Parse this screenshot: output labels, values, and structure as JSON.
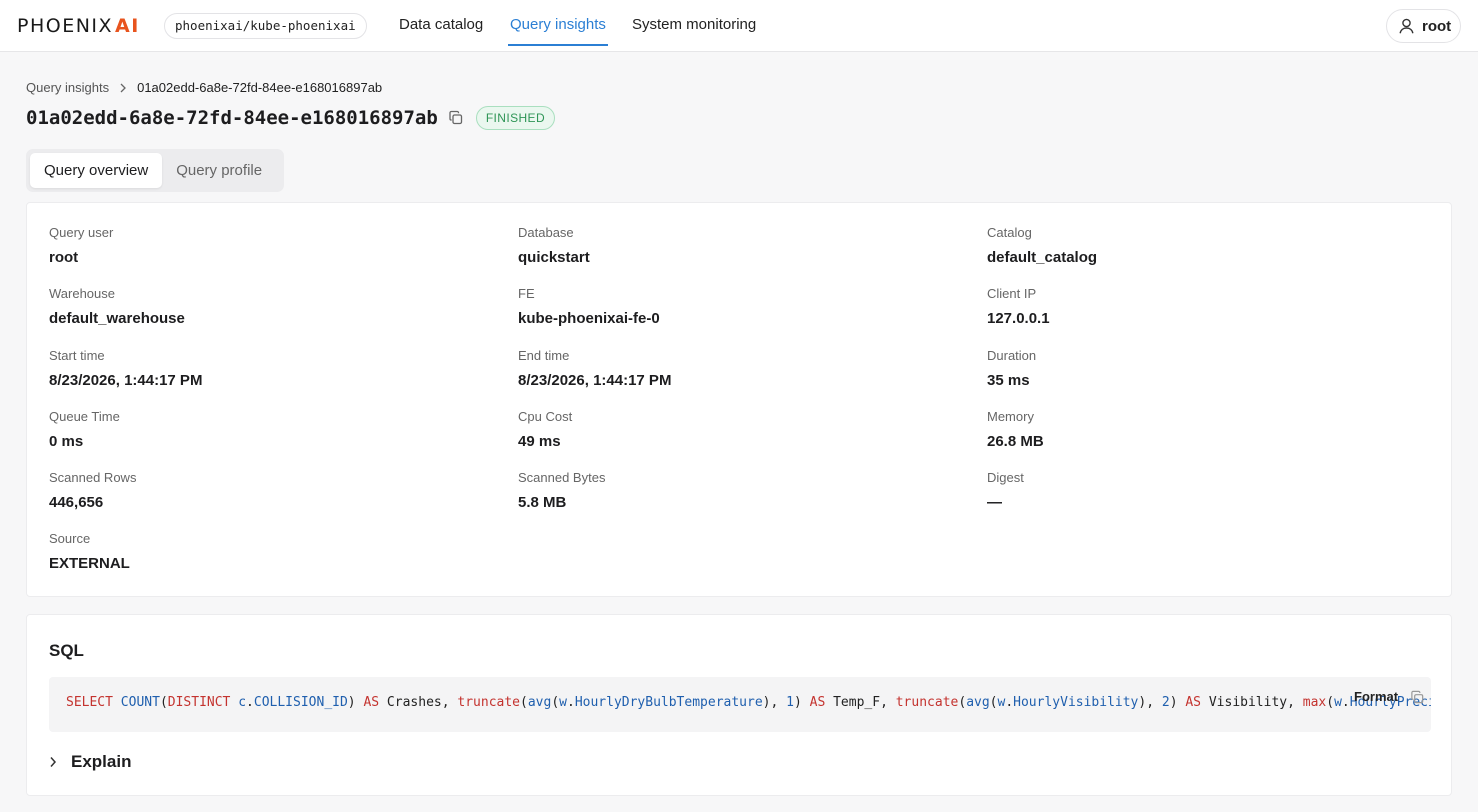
{
  "brand": {
    "logo_main": "PHOENIX",
    "logo_accent": "AI",
    "cluster": "phoenixai/kube-phoenixai"
  },
  "nav": {
    "items": [
      "Data catalog",
      "Query insights",
      "System monitoring"
    ],
    "active": "Query insights"
  },
  "user": {
    "name": "root",
    "icon": "user-icon"
  },
  "breadcrumb": {
    "parent": "Query insights",
    "current": "01a02edd-6a8e-72fd-84ee-e168016897ab"
  },
  "query": {
    "id": "01a02edd-6a8e-72fd-84ee-e168016897ab",
    "status": "FINISHED",
    "status_color": "#2e9556"
  },
  "tabs": [
    "Query overview",
    "Query profile"
  ],
  "details": [
    {
      "label": "Query user",
      "value": "root"
    },
    {
      "label": "Database",
      "value": "quickstart"
    },
    {
      "label": "Catalog",
      "value": "default_catalog"
    },
    {
      "label": "Warehouse",
      "value": "default_warehouse"
    },
    {
      "label": "FE",
      "value": "kube-phoenixai-fe-0"
    },
    {
      "label": "Client IP",
      "value": "127.0.0.1"
    },
    {
      "label": "Start time",
      "value": "8/23/2026, 1:44:17 PM"
    },
    {
      "label": "End time",
      "value": "8/23/2026, 1:44:17 PM"
    },
    {
      "label": "Duration",
      "value": "35 ms"
    },
    {
      "label": "Queue Time",
      "value": "0 ms"
    },
    {
      "label": "Cpu Cost",
      "value": "49 ms"
    },
    {
      "label": "Memory",
      "value": "26.8 MB"
    },
    {
      "label": "Scanned Rows",
      "value": "446,656"
    },
    {
      "label": "Scanned Bytes",
      "value": "5.8 MB"
    },
    {
      "label": "Digest",
      "value": "—"
    },
    {
      "label": "Source",
      "value": "EXTERNAL"
    }
  ],
  "sql": {
    "heading": "SQL",
    "format_label": "Format",
    "tokens": [
      [
        "kw",
        "SELECT"
      ],
      [
        "",
        " "
      ],
      [
        "fn",
        "COUNT"
      ],
      [
        "",
        "("
      ],
      [
        "kw",
        "DISTINCT"
      ],
      [
        "",
        " "
      ],
      [
        "fn",
        "c"
      ],
      [
        "",
        "."
      ],
      [
        "fn",
        "COLLISION_ID"
      ],
      [
        "",
        ") "
      ],
      [
        "kw",
        "AS"
      ],
      [
        "",
        " Crashes, "
      ],
      [
        "kw",
        "truncate"
      ],
      [
        "",
        "("
      ],
      [
        "fn",
        "avg"
      ],
      [
        "",
        "("
      ],
      [
        "fn",
        "w"
      ],
      [
        "",
        "."
      ],
      [
        "fn",
        "HourlyDryBulbTemperature"
      ],
      [
        "",
        "), "
      ],
      [
        "num",
        "1"
      ],
      [
        "",
        ") "
      ],
      [
        "kw",
        "AS"
      ],
      [
        "",
        " Temp_F, "
      ],
      [
        "kw",
        "truncate"
      ],
      [
        "",
        "("
      ],
      [
        "fn",
        "avg"
      ],
      [
        "",
        "("
      ],
      [
        "fn",
        "w"
      ],
      [
        "",
        "."
      ],
      [
        "fn",
        "HourlyVisibility"
      ],
      [
        "",
        "), "
      ],
      [
        "num",
        "2"
      ],
      [
        "",
        ") "
      ],
      [
        "kw",
        "AS"
      ],
      [
        "",
        " Visibility, "
      ],
      [
        "kw",
        "max"
      ],
      [
        "",
        "("
      ],
      [
        "fn",
        "w"
      ],
      [
        "",
        "."
      ],
      [
        "fn",
        "HourlyPrecip"
      ]
    ]
  },
  "explain_label": "Explain"
}
